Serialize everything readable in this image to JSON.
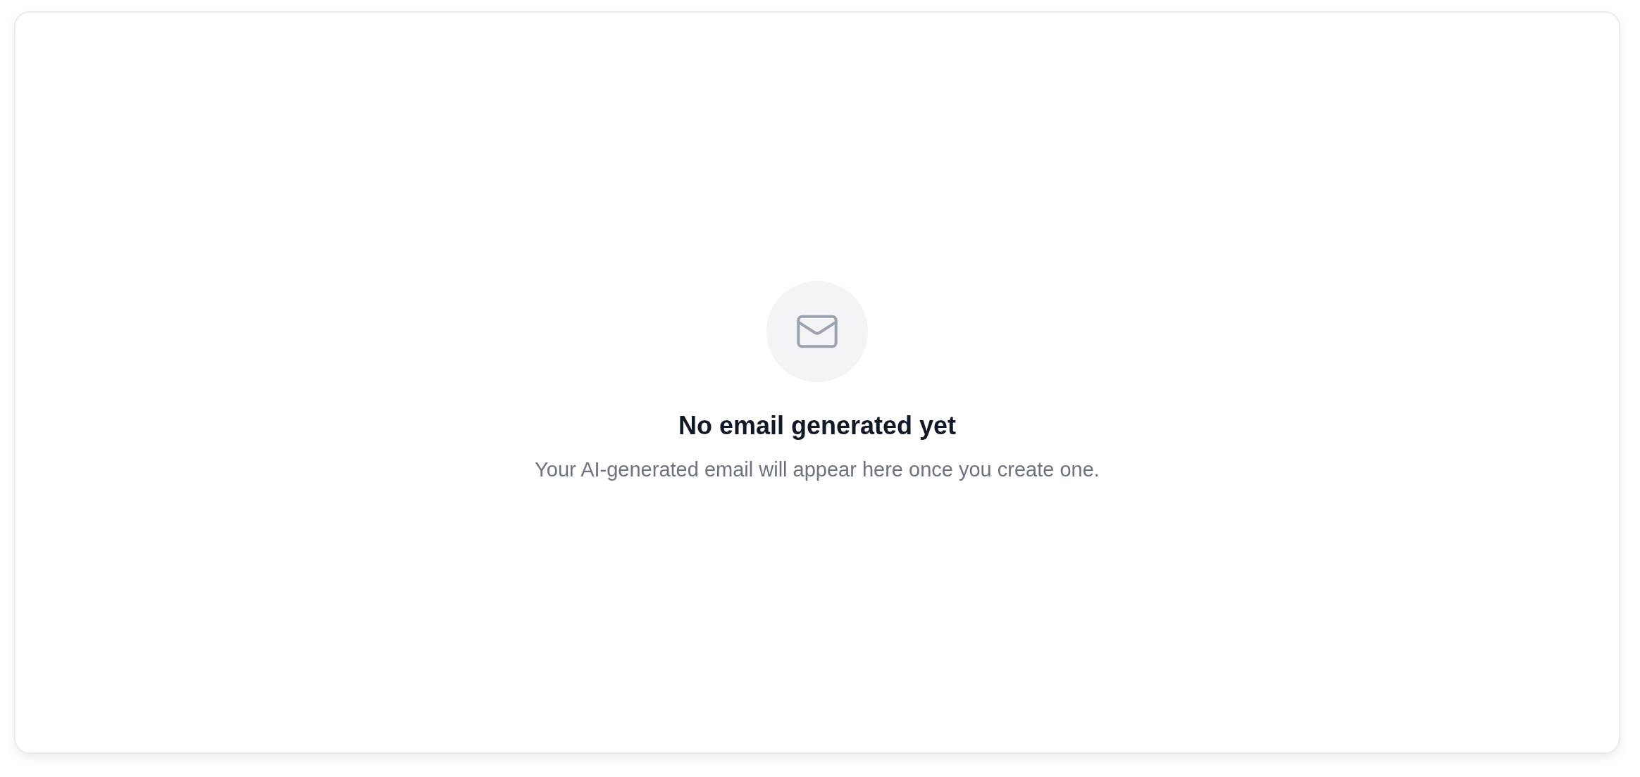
{
  "empty_state": {
    "title": "No email generated yet",
    "message": "Your AI-generated email will appear here once you create one."
  }
}
